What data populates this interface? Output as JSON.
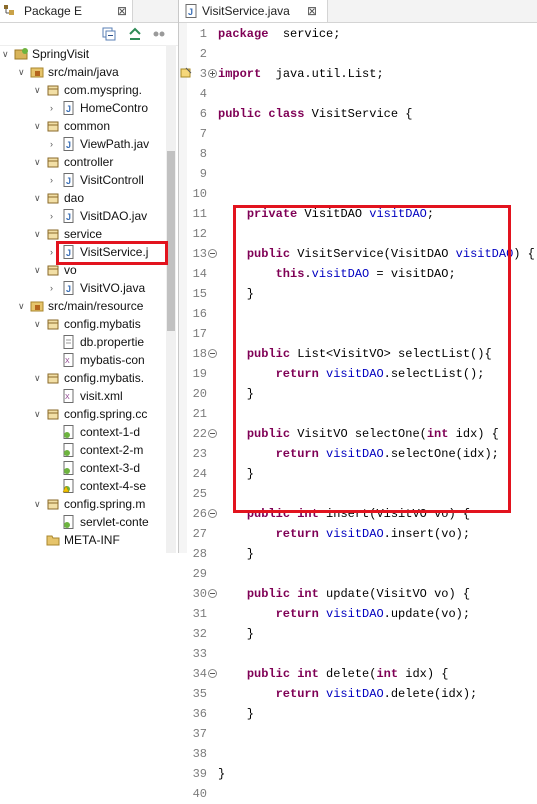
{
  "explorer": {
    "tab_label": "Package E",
    "tab_close": "⊠",
    "items": [
      {
        "label": "SpringVisit",
        "icon": "spring-project-icon",
        "arrow": "down"
      },
      {
        "label": "src/main/java",
        "icon": "source-folder-icon",
        "arrow": "down"
      },
      {
        "label": "com.myspring.",
        "icon": "package-icon",
        "arrow": "down"
      },
      {
        "label": "HomeContro",
        "icon": "java-file-icon",
        "arrow": "right"
      },
      {
        "label": "common",
        "icon": "package-icon",
        "arrow": "down"
      },
      {
        "label": "ViewPath.jav",
        "icon": "java-file-icon",
        "arrow": "right"
      },
      {
        "label": "controller",
        "icon": "package-icon",
        "arrow": "down"
      },
      {
        "label": "VisitControll",
        "icon": "java-file-icon",
        "arrow": "right"
      },
      {
        "label": "dao",
        "icon": "package-icon",
        "arrow": "down"
      },
      {
        "label": "VisitDAO.jav",
        "icon": "java-file-icon",
        "arrow": "right"
      },
      {
        "label": "service",
        "icon": "package-icon",
        "arrow": "down"
      },
      {
        "label": "VisitService.j",
        "icon": "java-file-icon",
        "arrow": "right"
      },
      {
        "label": "vo",
        "icon": "package-icon",
        "arrow": "down"
      },
      {
        "label": "VisitVO.java",
        "icon": "java-file-icon",
        "arrow": "right"
      },
      {
        "label": "src/main/resource",
        "icon": "source-folder-icon",
        "arrow": "down"
      },
      {
        "label": "config.mybatis",
        "icon": "package-icon",
        "arrow": "down"
      },
      {
        "label": "db.propertie",
        "icon": "file-icon",
        "arrow": ""
      },
      {
        "label": "mybatis-con",
        "icon": "xml-file-icon",
        "arrow": ""
      },
      {
        "label": "config.mybatis.",
        "icon": "package-icon",
        "arrow": "down"
      },
      {
        "label": "visit.xml",
        "icon": "xml-file-icon",
        "arrow": ""
      },
      {
        "label": "config.spring.cc",
        "icon": "package-icon",
        "arrow": "down"
      },
      {
        "label": "context-1-d",
        "icon": "spring-xml-icon",
        "arrow": ""
      },
      {
        "label": "context-2-m",
        "icon": "spring-xml-icon",
        "arrow": ""
      },
      {
        "label": "context-3-d",
        "icon": "spring-xml-icon",
        "arrow": ""
      },
      {
        "label": "context-4-se",
        "icon": "spring-xml-warning-icon",
        "arrow": ""
      },
      {
        "label": "config.spring.m",
        "icon": "package-icon",
        "arrow": "down"
      },
      {
        "label": "servlet-conte",
        "icon": "spring-xml-icon",
        "arrow": ""
      },
      {
        "label": "META-INF",
        "icon": "folder-icon",
        "arrow": ""
      }
    ]
  },
  "editor": {
    "tab_label": "VisitService.java",
    "tab_close": "⊠",
    "lines": [
      {
        "n": "1",
        "tokens": [
          [
            "kw",
            "package"
          ],
          [
            "",
            "  service;"
          ]
        ]
      },
      {
        "n": "2",
        "tokens": []
      },
      {
        "n": "3",
        "tokens": [
          [
            "kw",
            "import"
          ],
          [
            "",
            "  java.util.List;"
          ]
        ],
        "fold": "plus",
        "marker": true
      },
      {
        "n": "4",
        "tokens": []
      },
      {
        "n": "6",
        "tokens": [
          [
            "kw",
            "public"
          ],
          [
            "",
            " "
          ],
          [
            "kw",
            "class"
          ],
          [
            "",
            " VisitService {"
          ]
        ]
      },
      {
        "n": "7",
        "tokens": []
      },
      {
        "n": "8",
        "tokens": []
      },
      {
        "n": "9",
        "tokens": []
      },
      {
        "n": "10",
        "tokens": []
      },
      {
        "n": "11",
        "tokens": [
          [
            "",
            "    "
          ],
          [
            "kw",
            "private"
          ],
          [
            "",
            " VisitDAO "
          ],
          [
            "fd",
            "visitDAO"
          ],
          [
            "",
            ";"
          ]
        ]
      },
      {
        "n": "12",
        "tokens": []
      },
      {
        "n": "13",
        "tokens": [
          [
            "",
            "    "
          ],
          [
            "kw",
            "public"
          ],
          [
            "",
            " VisitService(VisitDAO "
          ],
          [
            "fd",
            "visitDAO"
          ],
          [
            "",
            ") {"
          ]
        ],
        "fold": "minus"
      },
      {
        "n": "14",
        "tokens": [
          [
            "",
            "        "
          ],
          [
            "kw",
            "this"
          ],
          [
            "",
            "."
          ],
          [
            "fd",
            "visitDAO"
          ],
          [
            "",
            " = visitDAO;"
          ]
        ]
      },
      {
        "n": "15",
        "tokens": [
          [
            "",
            "    }"
          ]
        ]
      },
      {
        "n": "16",
        "tokens": []
      },
      {
        "n": "17",
        "tokens": []
      },
      {
        "n": "18",
        "tokens": [
          [
            "",
            "    "
          ],
          [
            "kw",
            "public"
          ],
          [
            "",
            " List<VisitVO> selectList(){"
          ]
        ],
        "fold": "minus"
      },
      {
        "n": "19",
        "tokens": [
          [
            "",
            "        "
          ],
          [
            "kw",
            "return"
          ],
          [
            "",
            " "
          ],
          [
            "fd",
            "visitDAO"
          ],
          [
            "",
            ".selectList();"
          ]
        ]
      },
      {
        "n": "20",
        "tokens": [
          [
            "",
            "    }"
          ]
        ]
      },
      {
        "n": "21",
        "tokens": []
      },
      {
        "n": "22",
        "tokens": [
          [
            "",
            "    "
          ],
          [
            "kw",
            "public"
          ],
          [
            "",
            " VisitVO selectOne("
          ],
          [
            "kw",
            "int"
          ],
          [
            "",
            " idx) {"
          ]
        ],
        "fold": "minus"
      },
      {
        "n": "23",
        "tokens": [
          [
            "",
            "        "
          ],
          [
            "kw",
            "return"
          ],
          [
            "",
            " "
          ],
          [
            "fd",
            "visitDAO"
          ],
          [
            "",
            ".selectOne(idx);"
          ]
        ]
      },
      {
        "n": "24",
        "tokens": [
          [
            "",
            "    }"
          ]
        ]
      },
      {
        "n": "25",
        "tokens": []
      },
      {
        "n": "26",
        "tokens": [
          [
            "",
            "    "
          ],
          [
            "kw",
            "public"
          ],
          [
            "",
            " "
          ],
          [
            "kw",
            "int"
          ],
          [
            "",
            " insert(VisitVO vo) {"
          ]
        ],
        "fold": "minus"
      },
      {
        "n": "27",
        "tokens": [
          [
            "",
            "        "
          ],
          [
            "kw",
            "return"
          ],
          [
            "",
            " "
          ],
          [
            "fd",
            "visitDAO"
          ],
          [
            "",
            ".insert(vo);"
          ]
        ]
      },
      {
        "n": "28",
        "tokens": [
          [
            "",
            "    }"
          ]
        ]
      },
      {
        "n": "29",
        "tokens": []
      },
      {
        "n": "30",
        "tokens": [
          [
            "",
            "    "
          ],
          [
            "kw",
            "public"
          ],
          [
            "",
            " "
          ],
          [
            "kw",
            "int"
          ],
          [
            "",
            " update(VisitVO vo) {"
          ]
        ],
        "fold": "minus"
      },
      {
        "n": "31",
        "tokens": [
          [
            "",
            "        "
          ],
          [
            "kw",
            "return"
          ],
          [
            "",
            " "
          ],
          [
            "fd",
            "visitDAO"
          ],
          [
            "",
            ".update(vo);"
          ]
        ]
      },
      {
        "n": "32",
        "tokens": [
          [
            "",
            "    }"
          ]
        ]
      },
      {
        "n": "33",
        "tokens": []
      },
      {
        "n": "34",
        "tokens": [
          [
            "",
            "    "
          ],
          [
            "kw",
            "public"
          ],
          [
            "",
            " "
          ],
          [
            "kw",
            "int"
          ],
          [
            "",
            " delete("
          ],
          [
            "kw",
            "int"
          ],
          [
            "",
            " idx) {"
          ]
        ],
        "fold": "minus"
      },
      {
        "n": "35",
        "tokens": [
          [
            "",
            "        "
          ],
          [
            "kw",
            "return"
          ],
          [
            "",
            " "
          ],
          [
            "fd",
            "visitDAO"
          ],
          [
            "",
            ".delete(idx);"
          ]
        ]
      },
      {
        "n": "36",
        "tokens": [
          [
            "",
            "    }"
          ]
        ]
      },
      {
        "n": "37",
        "tokens": []
      },
      {
        "n": "38",
        "tokens": []
      },
      {
        "n": "39",
        "tokens": [
          [
            "",
            "}"
          ]
        ]
      },
      {
        "n": "40",
        "tokens": []
      }
    ]
  },
  "colors": {
    "keyword": "#7f0055",
    "field": "#0000c0",
    "highlight": "#e2131e"
  }
}
